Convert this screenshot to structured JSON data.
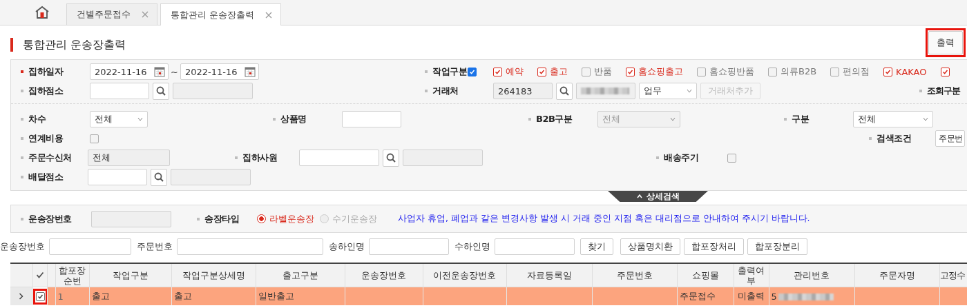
{
  "tabs": [
    {
      "label": "건별주문접수",
      "selected": false
    },
    {
      "label": "통합관리 운송장출력",
      "selected": true
    }
  ],
  "page_title": "통합관리 운송장출력",
  "print_button": {
    "label": "출력",
    "highlighted": true
  },
  "search_panel": {
    "groups": [
      {
        "rows": [
          [
            {
              "label": "집하일자",
              "required": true,
              "controls": [
                {
                  "kind": "date",
                  "value": "2022-11-16"
                },
                {
                  "kind": "sep",
                  "text": "~"
                },
                {
                  "kind": "date",
                  "value": "2022-11-16"
                }
              ]
            },
            {
              "label": "작업구분",
              "required": false,
              "all_checked": true,
              "controls": [
                {
                  "kind": "option",
                  "label": "예약",
                  "checked": true
                },
                {
                  "kind": "option",
                  "label": "출고",
                  "checked": true
                },
                {
                  "kind": "option",
                  "label": "반품",
                  "checked": false
                },
                {
                  "kind": "option",
                  "label": "홈쇼핑출고",
                  "checked": true
                },
                {
                  "kind": "option",
                  "label": "홈쇼핑반품",
                  "checked": false
                },
                {
                  "kind": "option",
                  "label": "의류B2B",
                  "checked": false
                },
                {
                  "kind": "option",
                  "label": "편의점",
                  "checked": false
                },
                {
                  "kind": "option",
                  "label": "KAKAO",
                  "checked": true
                },
                {
                  "kind": "option",
                  "checked": true
                }
              ]
            }
          ],
          [
            {
              "label": "집하점소",
              "required": false,
              "controls": [
                {
                  "kind": "text"
                },
                {
                  "kind": "search"
                },
                {
                  "kind": "readonly"
                }
              ]
            },
            {
              "label": "거래처",
              "required": false,
              "controls": [
                {
                  "kind": "readonly",
                  "value": "264183"
                },
                {
                  "kind": "search"
                },
                {
                  "kind": "blurred"
                },
                {
                  "kind": "select",
                  "value": "업무",
                  "disabled": false
                },
                {
                  "kind": "button",
                  "label": "거래처추가",
                  "disabled": true
                }
              ]
            },
            {
              "label": "조회구분",
              "required": false
            }
          ]
        ]
      },
      {
        "rows": [
          [
            {
              "label": "차수",
              "required": false,
              "controls": [
                {
                  "kind": "select",
                  "value": "전체",
                  "disabled": false
                }
              ]
            },
            {
              "label": "상품명",
              "required": false,
              "controls": [
                {
                  "kind": "text"
                }
              ]
            },
            {
              "label": "B2B구분",
              "required": false,
              "controls": [
                {
                  "kind": "select",
                  "value": "전체",
                  "disabled": true
                }
              ]
            },
            {
              "label": "구분",
              "required": false,
              "controls": [
                {
                  "kind": "select",
                  "value": "전체",
                  "disabled": false
                }
              ]
            }
          ],
          [
            {
              "label": "연계비용",
              "required": false,
              "controls": [
                {
                  "kind": "checkbox",
                  "checked": false
                }
              ]
            },
            {
              "label": "검색조건",
              "required": false,
              "controls": [
                {
                  "kind": "select",
                  "value": "주문번",
                  "disabled": false
                }
              ]
            }
          ],
          [
            {
              "label": "주문수신처",
              "required": false,
              "controls": [
                {
                  "kind": "readonly",
                  "value": "전체"
                }
              ]
            },
            {
              "label": "집하사원",
              "required": false,
              "controls": [
                {
                  "kind": "text"
                },
                {
                  "kind": "search"
                },
                {
                  "kind": "readonly"
                }
              ]
            },
            {
              "label": "배송주기",
              "required": false,
              "controls": [
                {
                  "kind": "checkbox",
                  "checked": false
                }
              ]
            }
          ],
          [
            {
              "label": "배달점소",
              "required": false,
              "controls": [
                {
                  "kind": "text"
                },
                {
                  "kind": "search"
                },
                {
                  "kind": "readonly"
                }
              ]
            }
          ]
        ]
      }
    ]
  },
  "detail_toggle": {
    "label": "상세검색",
    "expanded": true
  },
  "invoice_panel": {
    "waybill_label": "운송장번호",
    "type_label": "송장타입",
    "type_options": [
      {
        "label": "라벨운송장",
        "selected": true
      },
      {
        "label": "수기운송장",
        "selected": false
      }
    ],
    "notice": "사업자 휴업, 폐업과 같은 변경사항 발생 시 거래 중인 지점 혹은 대리점으로 안내하여 주시기 바랍니다."
  },
  "filter_bar": {
    "fields": [
      {
        "label": "운송장번호"
      },
      {
        "label": "주문번호"
      },
      {
        "label": "송하인명"
      },
      {
        "label": "수하인명"
      }
    ],
    "buttons": [
      "찾기",
      "상품명치환",
      "합포장처리",
      "합포장분리"
    ]
  },
  "table": {
    "columns": [
      {
        "kind": "expander"
      },
      {
        "kind": "check"
      },
      {
        "kind": "spacer"
      },
      {
        "kind": "text",
        "label": "합포장순번"
      },
      {
        "kind": "text",
        "label": "작업구분"
      },
      {
        "kind": "text",
        "label": "작업구분상세명"
      },
      {
        "kind": "text",
        "label": "출고구분"
      },
      {
        "kind": "text",
        "label": "운송장번호"
      },
      {
        "kind": "text",
        "label": "이전운송장번호"
      },
      {
        "kind": "text",
        "label": "자료등록일"
      },
      {
        "kind": "text",
        "label": "주문번호"
      },
      {
        "kind": "text",
        "label": "쇼핑몰"
      },
      {
        "kind": "text",
        "label": "출력여부"
      },
      {
        "kind": "text",
        "label": "관리번호"
      },
      {
        "kind": "text",
        "label": "주문자명"
      },
      {
        "kind": "text",
        "label": "고정수"
      }
    ],
    "rows": [
      {
        "selected": true,
        "checked": true,
        "highlighted": true,
        "cells": [
          "",
          "",
          "",
          "1",
          "출고",
          "출고",
          "일반출고",
          "",
          "",
          "",
          "",
          "주문접수",
          "미출력",
          {
            "text": "5",
            "redacted": true
          },
          "",
          ""
        ]
      }
    ]
  }
}
